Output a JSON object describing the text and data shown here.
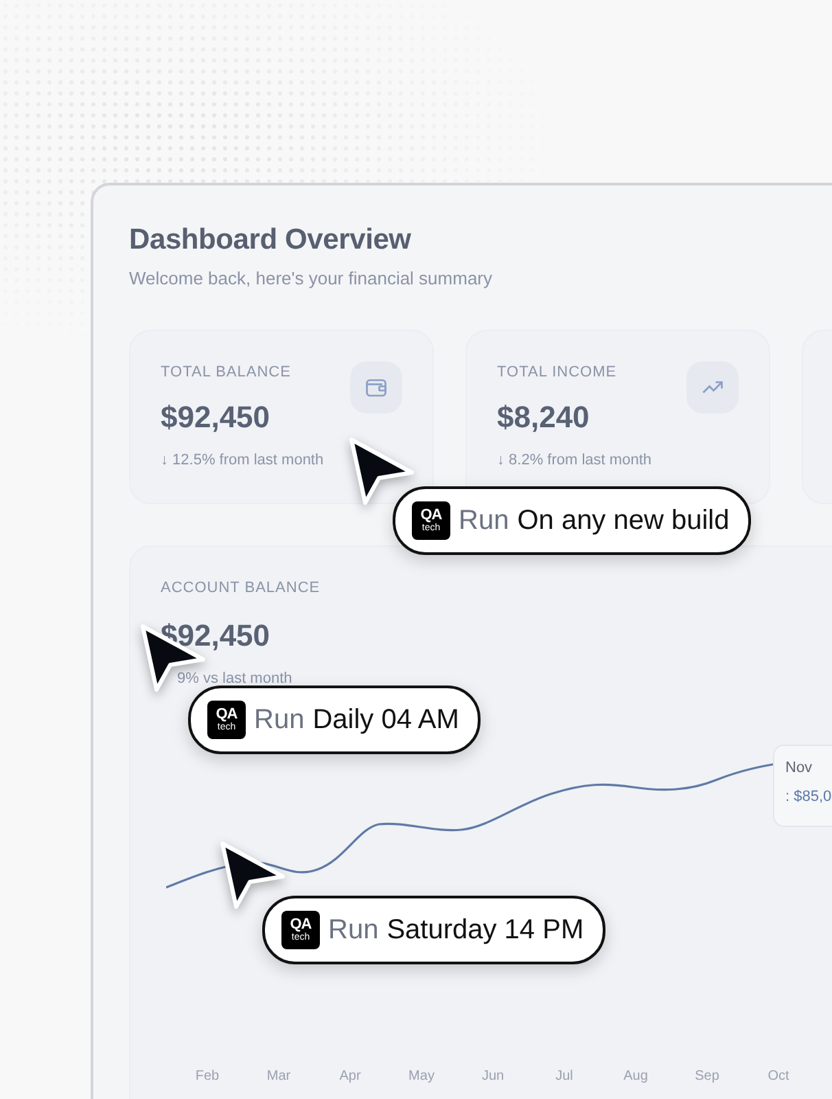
{
  "header": {
    "title": "Dashboard Overview",
    "subtitle": "Welcome back, here's your financial summary"
  },
  "stat_cards": [
    {
      "kind": "wallet",
      "label": "TOTAL BALANCE",
      "value": "$92,450",
      "change": "↓ 12.5% from last month"
    },
    {
      "kind": "trend",
      "label": "TOTAL INCOME",
      "value": "$8,240",
      "change": "↓ 8.2% from last month"
    }
  ],
  "balance_chart": {
    "label": "ACCOUNT BALANCE",
    "value": "$92,450",
    "change": "9% vs last month",
    "months": [
      "Feb",
      "Mar",
      "Apr",
      "May",
      "Jun",
      "Jul",
      "Aug",
      "Sep",
      "Oct"
    ],
    "tooltip": {
      "month": "Nov",
      "value": ": $85,0"
    }
  },
  "schedule_badges": [
    {
      "logo_top": "QA",
      "logo_bottom": "tech",
      "prefix": "Run",
      "schedule": "On any new build"
    },
    {
      "logo_top": "QA",
      "logo_bottom": "tech",
      "prefix": "Run",
      "schedule": "Daily 04 AM"
    },
    {
      "logo_top": "QA",
      "logo_bottom": "tech",
      "prefix": "Run",
      "schedule": "Saturday 14 PM"
    }
  ]
}
